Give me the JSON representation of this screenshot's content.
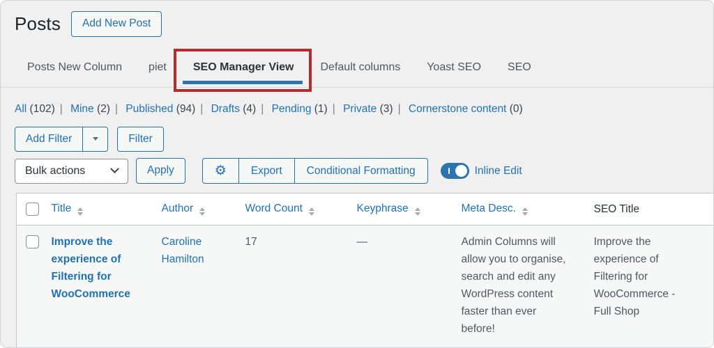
{
  "page": {
    "title": "Posts",
    "add_new_button": "Add New Post"
  },
  "tabs": {
    "items": [
      {
        "label": "Posts New Column",
        "active": false
      },
      {
        "label": "piet",
        "active": false
      },
      {
        "label": "SEO Manager View",
        "active": true,
        "highlighted": true
      },
      {
        "label": "Default columns",
        "active": false
      },
      {
        "label": "Yoast SEO",
        "active": false
      },
      {
        "label": "SEO",
        "active": false
      }
    ]
  },
  "status_filters": [
    {
      "label": "All",
      "count": "(102)"
    },
    {
      "label": "Mine",
      "count": "(2)"
    },
    {
      "label": "Published",
      "count": "(94)"
    },
    {
      "label": "Drafts",
      "count": "(4)"
    },
    {
      "label": "Pending",
      "count": "(1)"
    },
    {
      "label": "Private",
      "count": "(3)"
    },
    {
      "label": "Cornerstone content",
      "count": "(0)"
    }
  ],
  "ui": {
    "separator": "|",
    "gear_icon": "⚙"
  },
  "filter_bar": {
    "add_filter_label": "Add Filter",
    "filter_label": "Filter"
  },
  "actions_bar": {
    "bulk_actions_label": "Bulk actions",
    "apply_label": "Apply",
    "export_label": "Export",
    "conditional_formatting_label": "Conditional Formatting",
    "inline_edit_label": "Inline Edit",
    "inline_edit_on": true
  },
  "table": {
    "columns": [
      {
        "label": "Title",
        "sortable": true
      },
      {
        "label": "Author",
        "sortable": true
      },
      {
        "label": "Word Count",
        "sortable": true
      },
      {
        "label": "Keyphrase",
        "sortable": true
      },
      {
        "label": "Meta Desc.",
        "sortable": true
      },
      {
        "label": "SEO Title",
        "sortable": false
      }
    ],
    "rows": [
      {
        "title": "Improve the experience of Filtering for WooCommerce",
        "author": "Caroline Hamilton",
        "word_count": "17",
        "keyphrase": "—",
        "meta_desc": "Admin Columns will allow you to organise, search and edit any WordPress content faster than ever before!",
        "seo_title": "Improve the experience of Filtering for WooCommerce - Full Shop"
      }
    ]
  },
  "colors": {
    "accent_blue": "#2271b1",
    "active_tab_underline": "#2e73ad",
    "highlight_red": "#b32d2e",
    "page_bg": "#f0f0f1",
    "row_bg": "#f6f7f7",
    "text_dark": "#2c3338",
    "text_gray": "#50575e"
  }
}
